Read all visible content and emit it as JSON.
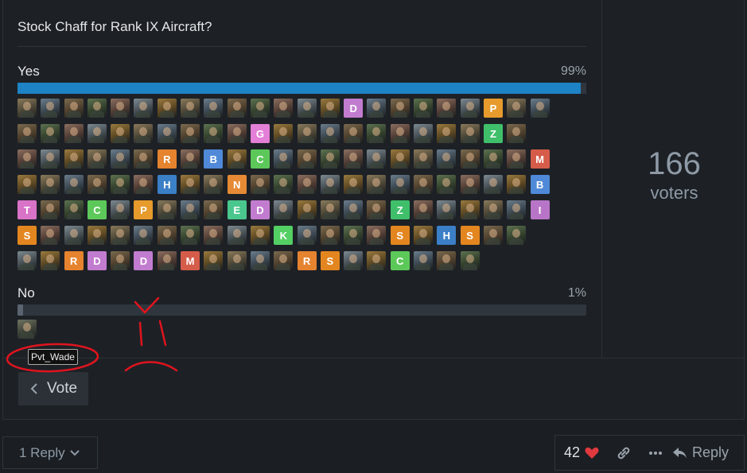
{
  "poll": {
    "title": "Stock Chaff for Rank IX Aircraft?",
    "options": [
      {
        "label": "Yes",
        "percent_text": "99%",
        "fraction": 0.99
      },
      {
        "label": "No",
        "percent_text": "1%",
        "fraction": 0.01
      }
    ],
    "voters_count": "166",
    "voters_label": "voters",
    "vote_button_label": "Vote"
  },
  "tooltip": {
    "username": "Pvt_Wade"
  },
  "yes_avatars": [
    "img",
    "img",
    "img",
    "img",
    "img",
    "img",
    "img",
    "img",
    "img",
    "img",
    "img",
    "img",
    "img",
    "img",
    "D",
    "img",
    "img",
    "img",
    "img",
    "img",
    "P",
    "img",
    "img",
    "img",
    "img",
    "img",
    "img",
    "img",
    "img",
    "img",
    "img",
    "img",
    "img",
    "G",
    "img",
    "img",
    "img",
    "img",
    "img",
    "img",
    "img",
    "img",
    "img",
    "Z",
    "img",
    "",
    "img",
    "img",
    "img",
    "img",
    "img",
    "img",
    "R",
    "img",
    "B",
    "img",
    "C",
    "img",
    "img",
    "img",
    "img",
    "img",
    "img",
    "img",
    "img",
    "img",
    "img",
    "img",
    "M",
    "img",
    "img",
    "img",
    "img",
    "img",
    "img",
    "H",
    "img",
    "img",
    "N",
    "img",
    "img",
    "img",
    "img",
    "img",
    "img",
    "img",
    "img",
    "img",
    "img",
    "img",
    "img",
    "B",
    "T",
    "img",
    "img",
    "C",
    "img",
    "P",
    "img",
    "img",
    "img",
    "E",
    "D",
    "img",
    "img",
    "img",
    "img",
    "img",
    "Z",
    "img",
    "img",
    "img",
    "img",
    "img",
    "I",
    "S",
    "img",
    "img",
    "img",
    "img",
    "img",
    "img",
    "img",
    "img",
    "img",
    "img",
    "K",
    "img",
    "img",
    "img",
    "img",
    "S",
    "img",
    "H",
    "S",
    "img",
    "img",
    "",
    "img",
    "img",
    "R",
    "D",
    "img",
    "D",
    "img",
    "M",
    "img",
    "img",
    "img",
    "img",
    "R",
    "S",
    "img",
    "img",
    "C",
    "img",
    "img",
    "img",
    "",
    "",
    ""
  ],
  "letter_colors": {
    "D": "#c27ccf",
    "P": "#e69b2c",
    "G": "#e37fd6",
    "Z": "#3fbf6a",
    "R": "#e5832f",
    "B": "#4f89d8",
    "C": "#5dc85a",
    "M": "#d65c4a",
    "H": "#3b7fc6",
    "N": "#e68a35",
    "T": "#d973c7",
    "E": "#4ac78d",
    "I": "#b875c7",
    "S": "#e3861f",
    "K": "#53cf64"
  },
  "footer": {
    "reply_count_label": "1 Reply",
    "likes_count": "42",
    "reply_label": "Reply"
  },
  "icons": [
    "chevron-left-icon",
    "chevron-down-icon",
    "heart-icon",
    "link-icon",
    "more-icon",
    "reply-icon"
  ],
  "colors": {
    "accent": "#1e83c4",
    "heart": "#e0393e",
    "annotation": "#e0141e"
  }
}
